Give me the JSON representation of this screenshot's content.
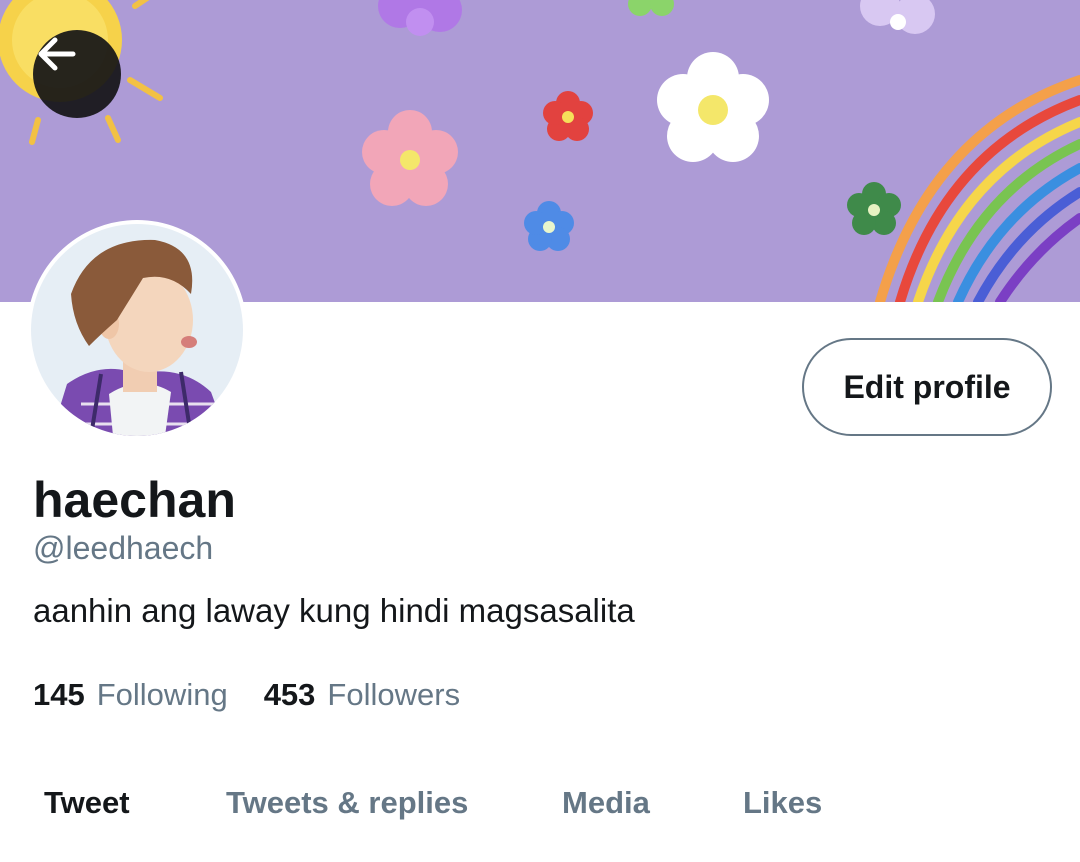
{
  "header": {
    "back_icon": "arrow-left-icon",
    "banner_colors": {
      "background": "#ad9bd6"
    }
  },
  "profile": {
    "display_name": "haechan",
    "handle": "@leedhaech",
    "bio": "aanhin ang laway kung hindi magsasalita",
    "edit_button_label": "Edit profile",
    "following_count": "145",
    "following_label": "Following",
    "followers_count": "453",
    "followers_label": "Followers"
  },
  "tabs": [
    {
      "label": "Tweet",
      "active": true
    },
    {
      "label": "Tweets & replies",
      "active": false
    },
    {
      "label": "Media",
      "active": false
    },
    {
      "label": "Likes",
      "active": false
    }
  ],
  "colors": {
    "text_primary": "#14171a",
    "text_secondary": "#657786",
    "button_border": "#657786"
  }
}
